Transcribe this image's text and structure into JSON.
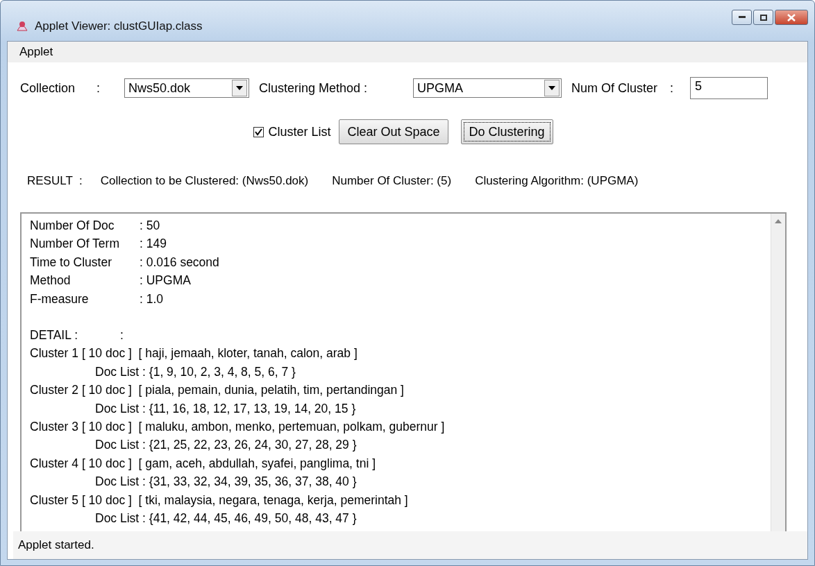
{
  "window": {
    "title": "Applet Viewer: clustGUIap.class"
  },
  "menu": [
    "Applet"
  ],
  "form": {
    "collection_label": "Collection",
    "collection_sep": ":",
    "collection": "Nws50.dok",
    "method_label": "Clustering Method :",
    "method": "UPGMA",
    "num_label": "Num Of Cluster",
    "num_sep": ":",
    "num": "5"
  },
  "options": {
    "cluster_list": {
      "label": "Cluster List",
      "checked": true
    },
    "buttons": [
      {
        "label": "Clear Out Space",
        "focused": false
      },
      {
        "label": "Do Clustering",
        "focused": true
      }
    ]
  },
  "result": [
    "RESULT  :",
    "Collection to be Clustered: (Nws50.dok)",
    "Number Of Cluster: (5)",
    "Clustering Algorithm: (UPGMA)"
  ],
  "output": {
    "summary": [
      {
        "label": "Number Of Doc",
        "value": ": 50"
      },
      {
        "label": "Number Of Term",
        "value": ": 149"
      },
      {
        "label": "Time to Cluster",
        "value": ": 0.016 second"
      },
      {
        "label": "Method",
        "value": ": UPGMA"
      },
      {
        "label": "F-measure",
        "value": ": 1.0"
      }
    ],
    "detail": {
      "label": "DETAIL :",
      "value": ":"
    },
    "clusters": [
      {
        "header": "Cluster 1 [ 10 doc ]  [ haji, jemaah, kloter, tanah, calon, arab ]",
        "doc_list": "Doc List : {1, 9, 10, 2, 3, 4, 8, 5, 6, 7 }"
      },
      {
        "header": "Cluster 2 [ 10 doc ]  [ piala, pemain, dunia, pelatih, tim, pertandingan ]",
        "doc_list": "Doc List : {11, 16, 18, 12, 17, 13, 19, 14, 20, 15 }"
      },
      {
        "header": "Cluster 3 [ 10 doc ]  [ maluku, ambon, menko, pertemuan, polkam, gubernur ]",
        "doc_list": "Doc List : {21, 25, 22, 23, 26, 24, 30, 27, 28, 29 }"
      },
      {
        "header": "Cluster 4 [ 10 doc ]  [ gam, aceh, abdullah, syafei, panglima, tni ]",
        "doc_list": "Doc List : {31, 33, 32, 34, 39, 35, 36, 37, 38, 40 }"
      },
      {
        "header": "Cluster 5 [ 10 doc ]  [ tki, malaysia, negara, tenaga, kerja, pemerintah ]",
        "doc_list": "Doc List : {41, 42, 44, 45, 46, 49, 50, 48, 43, 47 }"
      }
    ]
  },
  "status_bar": "Applet started."
}
